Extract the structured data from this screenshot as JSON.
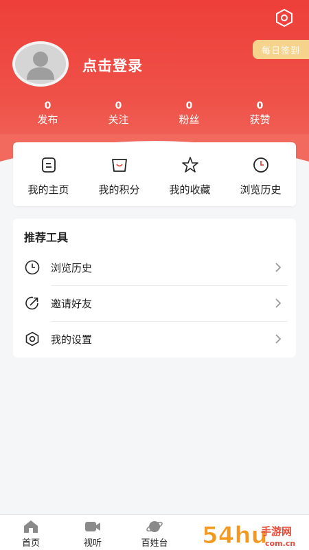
{
  "header": {
    "checkin_label": "每日签到",
    "login_label": "点击登录",
    "stats": [
      {
        "value": "0",
        "label": "发布"
      },
      {
        "value": "0",
        "label": "关注"
      },
      {
        "value": "0",
        "label": "粉丝"
      },
      {
        "value": "0",
        "label": "获赞"
      }
    ]
  },
  "quick": [
    {
      "label": "我的主页",
      "icon": "profile-page-icon"
    },
    {
      "label": "我的积分",
      "icon": "points-bag-icon"
    },
    {
      "label": "我的收藏",
      "icon": "star-icon"
    },
    {
      "label": "浏览历史",
      "icon": "clock-icon"
    }
  ],
  "tools": {
    "title": "推荐工具",
    "items": [
      {
        "label": "浏览历史",
        "icon": "clock-icon"
      },
      {
        "label": "邀请好友",
        "icon": "share-icon"
      },
      {
        "label": "我的设置",
        "icon": "settings-icon"
      }
    ]
  },
  "tabbar": [
    {
      "label": "首页",
      "icon": "home-icon"
    },
    {
      "label": "视听",
      "icon": "video-icon"
    },
    {
      "label": "百姓台",
      "icon": "planet-icon"
    }
  ],
  "watermark": {
    "text": "54hu手游网",
    "sub": "com.cn"
  },
  "colors": {
    "accent": "#ee4740",
    "checkin": "#f6d38c"
  }
}
